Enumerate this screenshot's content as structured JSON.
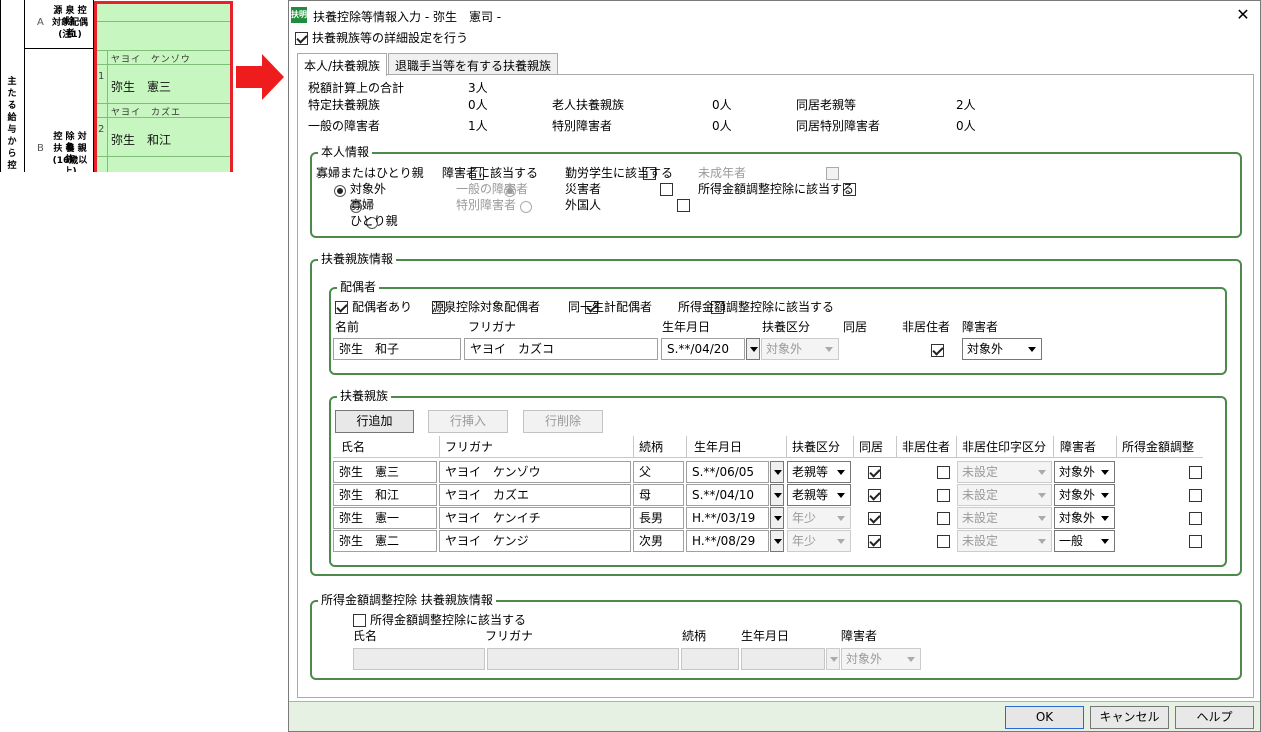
{
  "left_form": {
    "section_a_letter": "A",
    "section_a_label": [
      "源 泉 控 除",
      "対象配偶者",
      "(注1)"
    ],
    "section_b_letter": "B",
    "section_b_label": [
      "控 除 対 象",
      "扶 養 親 族",
      "(16歳以上)"
    ],
    "vertical_label": "主たる給与から控",
    "entries": [
      {
        "num": "1",
        "kana": "ヤヨイ　ケンゾウ",
        "name": "弥生　憲三"
      },
      {
        "num": "2",
        "kana": "ヤヨイ　カズエ",
        "name": "弥生　和江"
      }
    ]
  },
  "dialog": {
    "icon_label": "扶明",
    "title": "扶養控除等情報入力 - 弥生　憲司 -",
    "detail_checkbox_label": "扶養親族等の詳細設定を行う",
    "detail_checked": true,
    "tabs": [
      {
        "label": "本人/扶養親族",
        "active": true
      },
      {
        "label": "退職手当等を有する扶養親族",
        "active": false
      }
    ],
    "summary": {
      "total_label": "税額計算上の合計",
      "total_value": "3人",
      "rows": [
        [
          {
            "label": "特定扶養親族",
            "value": "0人"
          },
          {
            "label": "老人扶養親族",
            "value": "0人"
          },
          {
            "label": "同居老親等",
            "value": "2人"
          }
        ],
        [
          {
            "label": "一般の障害者",
            "value": "1人"
          },
          {
            "label": "特別障害者",
            "value": "0人"
          },
          {
            "label": "同居特別障害者",
            "value": "0人"
          }
        ]
      ]
    },
    "honnin": {
      "title": "本人情報",
      "widow_label": "寡婦またはひとり親",
      "widow_options": [
        {
          "label": "対象外",
          "selected": true
        },
        {
          "label": "寡婦",
          "selected": false
        },
        {
          "label": "ひとり親",
          "selected": false
        }
      ],
      "disabled_label": "障害者に該当する",
      "disabled_options": [
        {
          "label": "一般の障害者",
          "selected": true
        },
        {
          "label": "特別障害者",
          "selected": false
        }
      ],
      "student_label": "勤労学生に該当する",
      "disaster_label": "災害者",
      "foreigner_label": "外国人",
      "minor_label": "未成年者",
      "income_adj_label": "所得金額調整控除に該当する"
    },
    "fuyo": {
      "title": "扶養親族情報",
      "spouse": {
        "title": "配偶者",
        "flags": [
          {
            "label": "配偶者あり",
            "checked": true
          },
          {
            "label": "源泉控除対象配偶者",
            "checked": false
          },
          {
            "label": "同一生計配偶者",
            "checked": true
          },
          {
            "label": "所得金額調整控除に該当する",
            "checked": false
          }
        ],
        "headers": {
          "name": "名前",
          "kana": "フリガナ",
          "dob": "生年月日",
          "kubun": "扶養区分",
          "doukyo": "同居",
          "hikyojuu": "非居住者",
          "shougai": "障害者"
        },
        "name": "弥生　和子",
        "kana": "ヤヨイ　カズコ",
        "dob": "S.**/04/20",
        "kubun": "対象外",
        "doukyo": true,
        "hikyojuu": false,
        "shougai": "対象外"
      },
      "dependents": {
        "title": "扶養親族",
        "buttons": {
          "add": "行追加",
          "insert": "行挿入",
          "delete": "行削除"
        },
        "headers": [
          "氏名",
          "フリガナ",
          "続柄",
          "生年月日",
          "扶養区分",
          "同居",
          "非居住者",
          "非居住印字区分",
          "障害者",
          "所得金額調整"
        ],
        "rows": [
          {
            "name": "弥生　憲三",
            "kana": "ヤヨイ　ケンゾウ",
            "rel": "父",
            "dob": "S.**/06/05",
            "kubun": "老親等",
            "kubun_enabled": true,
            "doukyo": true,
            "hikyojuu": false,
            "print": "未設定",
            "shougai": "対象外",
            "adj": false
          },
          {
            "name": "弥生　和江",
            "kana": "ヤヨイ　カズエ",
            "rel": "母",
            "dob": "S.**/04/10",
            "kubun": "老親等",
            "kubun_enabled": true,
            "doukyo": true,
            "hikyojuu": false,
            "print": "未設定",
            "shougai": "対象外",
            "adj": false
          },
          {
            "name": "弥生　憲一",
            "kana": "ヤヨイ　ケンイチ",
            "rel": "長男",
            "dob": "H.**/03/19",
            "kubun": "年少",
            "kubun_enabled": false,
            "doukyo": true,
            "hikyojuu": false,
            "print": "未設定",
            "shougai": "対象外",
            "adj": false
          },
          {
            "name": "弥生　憲二",
            "kana": "ヤヨイ　ケンジ",
            "rel": "次男",
            "dob": "H.**/08/29",
            "kubun": "年少",
            "kubun_enabled": false,
            "doukyo": true,
            "hikyojuu": false,
            "print": "未設定",
            "shougai": "一般",
            "adj": false
          }
        ]
      }
    },
    "income_adj": {
      "title": "所得金額調整控除 扶養親族情報",
      "checkbox_label": "所得金額調整控除に該当する",
      "headers": {
        "name": "氏名",
        "kana": "フリガナ",
        "rel": "続柄",
        "dob": "生年月日",
        "shougai": "障害者"
      },
      "shougai": "対象外"
    },
    "footer": {
      "ok": "OK",
      "cancel": "キャンセル",
      "help": "ヘルプ"
    },
    "colors": {
      "group_border": "#4c8a4c",
      "footer_bg": "#e6f0e3",
      "highlight_box": "#e8202a",
      "form_green": "#c8f6c0"
    }
  }
}
